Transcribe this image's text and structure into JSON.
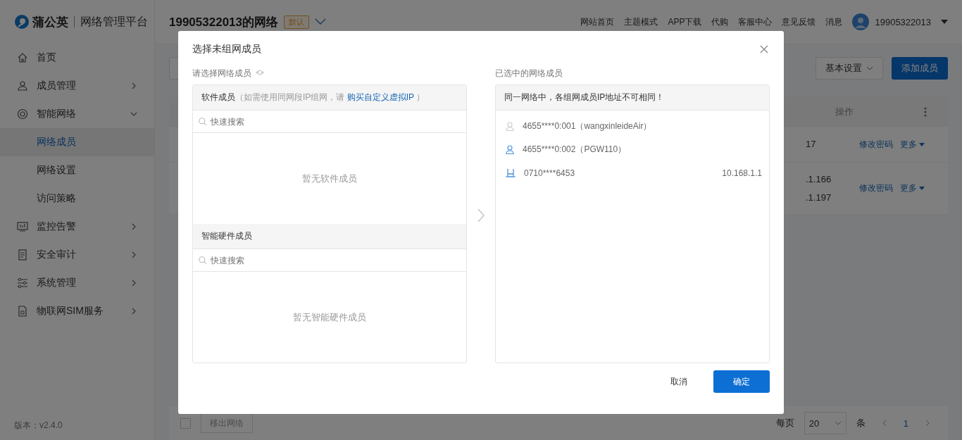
{
  "brand": {
    "name": "蒲公英",
    "product": "网络管理平台"
  },
  "sidebar": {
    "items": [
      {
        "label": "首页",
        "selected": false
      },
      {
        "label": "成员管理",
        "expanded": false,
        "selected": false
      },
      {
        "label": "智能网络",
        "expanded": true,
        "selected": false,
        "children": [
          {
            "label": "网络成员",
            "selected": true
          },
          {
            "label": "网络设置",
            "selected": false
          },
          {
            "label": "访问策略",
            "selected": false
          }
        ]
      },
      {
        "label": "监控告警",
        "expanded": false,
        "selected": false
      },
      {
        "label": "安全审计",
        "expanded": false,
        "selected": false
      },
      {
        "label": "系统管理",
        "expanded": false,
        "selected": false
      },
      {
        "label": "物联网SIM服务",
        "expanded": false,
        "selected": false
      }
    ],
    "version": "版本：v2.4.0"
  },
  "header": {
    "network_title": "19905322013的网络",
    "badge": "默认",
    "links": [
      "网站首页",
      "主题模式",
      "APP下载",
      "代购",
      "客服中心",
      "意见反馈",
      "消息"
    ],
    "user": "19905322013"
  },
  "toolbar": {
    "settings": "基本设置",
    "add_button": "添加成员"
  },
  "table": {
    "columns": [
      "操作"
    ],
    "rows": [
      {
        "ip": "17",
        "actions": [
          "修改密码",
          "更多"
        ]
      },
      {
        "ip": ".1.166\n.1.197",
        "actions": [
          "修改密码",
          "更多"
        ]
      }
    ]
  },
  "footer": {
    "select_all": {
      "checked": false
    },
    "remove_button": "移出网络",
    "per_page_label": "每页",
    "per_page": "20",
    "unit": "条",
    "page": "1"
  },
  "dialog": {
    "title": "选择未组网成员",
    "left": {
      "label": "请选择网络成员",
      "sections": [
        {
          "title": "软件成员",
          "note_start": "（如需使用同网段IP组网，请 ",
          "link": "购买自定义虚拟IP",
          "note_end": " ）",
          "search_placeholder": "快速搜索",
          "empty": "暂无软件成员"
        },
        {
          "title": "智能硬件成员",
          "search_placeholder": "快速搜索",
          "empty": "暂无智能硬件成员"
        }
      ]
    },
    "right": {
      "label": "已选中的网络成员",
      "notice": "同一网络中，各组网成员IP地址不可相同！",
      "members": [
        {
          "kind": "person",
          "online": false,
          "name": "4655****0:001（wangxinleideAir）"
        },
        {
          "kind": "person",
          "online": true,
          "name": "4655****0:002（PGW110）"
        },
        {
          "kind": "router",
          "online": true,
          "name": "0710****6453",
          "ip": "10.168.1.1"
        }
      ]
    },
    "buttons": {
      "cancel": "取消",
      "ok": "确定"
    }
  }
}
